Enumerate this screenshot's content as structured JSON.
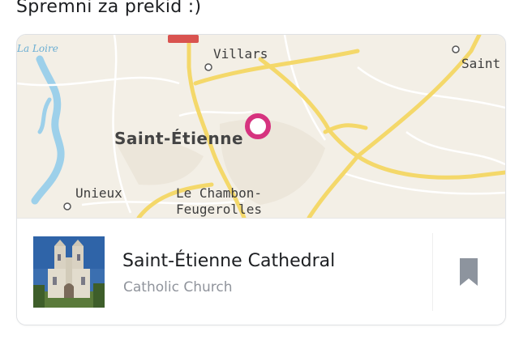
{
  "post": {
    "text": "Spremni za prekid :)"
  },
  "map": {
    "labels": {
      "river": "La Loire",
      "villars": "Villars",
      "saint_partial": "Saint",
      "saint_etienne": "Saint-Étienne",
      "unieux": "Unieux",
      "le_chambon_line1": "Le Chambon-",
      "le_chambon_line2": "Feugerolles"
    },
    "pin_icon": "map-pin-icon",
    "colors": {
      "land": "#f3efe6",
      "river": "#9dd0ea",
      "road_major": "#f4d86a",
      "road_minor": "#ffffff",
      "pin": "#d6337f"
    }
  },
  "place": {
    "name": "Saint-Étienne Cathedral",
    "category": "Catholic Church",
    "thumbnail_icon": "cathedral-photo",
    "bookmark_icon": "bookmark-icon"
  }
}
